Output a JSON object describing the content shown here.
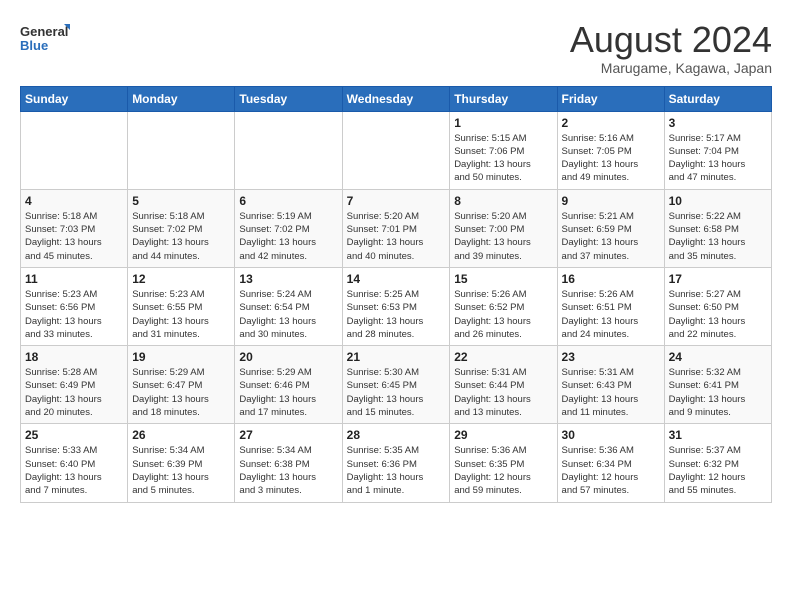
{
  "logo": {
    "line1": "General",
    "line2": "Blue"
  },
  "title": "August 2024",
  "location": "Marugame, Kagawa, Japan",
  "days_of_week": [
    "Sunday",
    "Monday",
    "Tuesday",
    "Wednesday",
    "Thursday",
    "Friday",
    "Saturday"
  ],
  "weeks": [
    [
      {
        "day": "",
        "info": ""
      },
      {
        "day": "",
        "info": ""
      },
      {
        "day": "",
        "info": ""
      },
      {
        "day": "",
        "info": ""
      },
      {
        "day": "1",
        "info": "Sunrise: 5:15 AM\nSunset: 7:06 PM\nDaylight: 13 hours\nand 50 minutes."
      },
      {
        "day": "2",
        "info": "Sunrise: 5:16 AM\nSunset: 7:05 PM\nDaylight: 13 hours\nand 49 minutes."
      },
      {
        "day": "3",
        "info": "Sunrise: 5:17 AM\nSunset: 7:04 PM\nDaylight: 13 hours\nand 47 minutes."
      }
    ],
    [
      {
        "day": "4",
        "info": "Sunrise: 5:18 AM\nSunset: 7:03 PM\nDaylight: 13 hours\nand 45 minutes."
      },
      {
        "day": "5",
        "info": "Sunrise: 5:18 AM\nSunset: 7:02 PM\nDaylight: 13 hours\nand 44 minutes."
      },
      {
        "day": "6",
        "info": "Sunrise: 5:19 AM\nSunset: 7:02 PM\nDaylight: 13 hours\nand 42 minutes."
      },
      {
        "day": "7",
        "info": "Sunrise: 5:20 AM\nSunset: 7:01 PM\nDaylight: 13 hours\nand 40 minutes."
      },
      {
        "day": "8",
        "info": "Sunrise: 5:20 AM\nSunset: 7:00 PM\nDaylight: 13 hours\nand 39 minutes."
      },
      {
        "day": "9",
        "info": "Sunrise: 5:21 AM\nSunset: 6:59 PM\nDaylight: 13 hours\nand 37 minutes."
      },
      {
        "day": "10",
        "info": "Sunrise: 5:22 AM\nSunset: 6:58 PM\nDaylight: 13 hours\nand 35 minutes."
      }
    ],
    [
      {
        "day": "11",
        "info": "Sunrise: 5:23 AM\nSunset: 6:56 PM\nDaylight: 13 hours\nand 33 minutes."
      },
      {
        "day": "12",
        "info": "Sunrise: 5:23 AM\nSunset: 6:55 PM\nDaylight: 13 hours\nand 31 minutes."
      },
      {
        "day": "13",
        "info": "Sunrise: 5:24 AM\nSunset: 6:54 PM\nDaylight: 13 hours\nand 30 minutes."
      },
      {
        "day": "14",
        "info": "Sunrise: 5:25 AM\nSunset: 6:53 PM\nDaylight: 13 hours\nand 28 minutes."
      },
      {
        "day": "15",
        "info": "Sunrise: 5:26 AM\nSunset: 6:52 PM\nDaylight: 13 hours\nand 26 minutes."
      },
      {
        "day": "16",
        "info": "Sunrise: 5:26 AM\nSunset: 6:51 PM\nDaylight: 13 hours\nand 24 minutes."
      },
      {
        "day": "17",
        "info": "Sunrise: 5:27 AM\nSunset: 6:50 PM\nDaylight: 13 hours\nand 22 minutes."
      }
    ],
    [
      {
        "day": "18",
        "info": "Sunrise: 5:28 AM\nSunset: 6:49 PM\nDaylight: 13 hours\nand 20 minutes."
      },
      {
        "day": "19",
        "info": "Sunrise: 5:29 AM\nSunset: 6:47 PM\nDaylight: 13 hours\nand 18 minutes."
      },
      {
        "day": "20",
        "info": "Sunrise: 5:29 AM\nSunset: 6:46 PM\nDaylight: 13 hours\nand 17 minutes."
      },
      {
        "day": "21",
        "info": "Sunrise: 5:30 AM\nSunset: 6:45 PM\nDaylight: 13 hours\nand 15 minutes."
      },
      {
        "day": "22",
        "info": "Sunrise: 5:31 AM\nSunset: 6:44 PM\nDaylight: 13 hours\nand 13 minutes."
      },
      {
        "day": "23",
        "info": "Sunrise: 5:31 AM\nSunset: 6:43 PM\nDaylight: 13 hours\nand 11 minutes."
      },
      {
        "day": "24",
        "info": "Sunrise: 5:32 AM\nSunset: 6:41 PM\nDaylight: 13 hours\nand 9 minutes."
      }
    ],
    [
      {
        "day": "25",
        "info": "Sunrise: 5:33 AM\nSunset: 6:40 PM\nDaylight: 13 hours\nand 7 minutes."
      },
      {
        "day": "26",
        "info": "Sunrise: 5:34 AM\nSunset: 6:39 PM\nDaylight: 13 hours\nand 5 minutes."
      },
      {
        "day": "27",
        "info": "Sunrise: 5:34 AM\nSunset: 6:38 PM\nDaylight: 13 hours\nand 3 minutes."
      },
      {
        "day": "28",
        "info": "Sunrise: 5:35 AM\nSunset: 6:36 PM\nDaylight: 13 hours\nand 1 minute."
      },
      {
        "day": "29",
        "info": "Sunrise: 5:36 AM\nSunset: 6:35 PM\nDaylight: 12 hours\nand 59 minutes."
      },
      {
        "day": "30",
        "info": "Sunrise: 5:36 AM\nSunset: 6:34 PM\nDaylight: 12 hours\nand 57 minutes."
      },
      {
        "day": "31",
        "info": "Sunrise: 5:37 AM\nSunset: 6:32 PM\nDaylight: 12 hours\nand 55 minutes."
      }
    ]
  ]
}
